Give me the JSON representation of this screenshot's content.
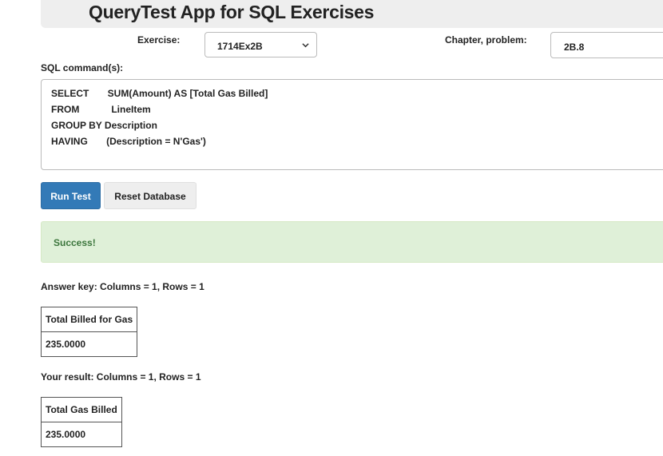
{
  "header": {
    "title": "QueryTest App for SQL Exercises"
  },
  "form": {
    "exercise_label": "Exercise:",
    "exercise_value": "1714Ex2B",
    "chapter_label": "Chapter, problem:",
    "chapter_value": "2B.8",
    "sql_label": "SQL command(s):",
    "sql_lines": [
      "SELECT       SUM(Amount) AS [Total Gas Billed]",
      "FROM            LineItem",
      "GROUP BY Description",
      "HAVING       (Description = N'Gas')"
    ]
  },
  "buttons": {
    "run_label": "Run Test",
    "reset_label": "Reset Database"
  },
  "alert": {
    "text": "Success!",
    "color": "#3c763d",
    "background": "#dff0d8"
  },
  "answer_key": {
    "summary": "Answer key: Columns = 1, Rows = 1",
    "columns": [
      "Total Billed for Gas"
    ],
    "rows": [
      [
        "235.0000"
      ]
    ]
  },
  "your_result": {
    "summary": "Your result: Columns = 1, Rows = 1",
    "columns": [
      "Total Gas Billed"
    ],
    "rows": [
      [
        "235.0000"
      ]
    ]
  },
  "colors": {
    "primary": "#337ab7",
    "header_bg": "#eeeeee"
  }
}
